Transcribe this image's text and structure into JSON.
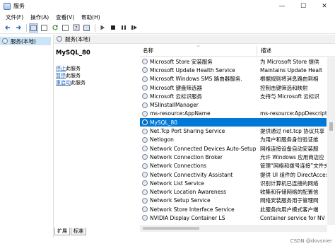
{
  "window": {
    "title": "服务",
    "minimize": "—",
    "maximize": "☐",
    "close": "✕"
  },
  "menu": [
    "文件(F)",
    "操作(A)",
    "查看(V)",
    "帮助(H)"
  ],
  "tree": {
    "root_label": "服务(本地)"
  },
  "main": {
    "header": "服务(本地)"
  },
  "detail": {
    "service_name": "MySQL_80",
    "actions": [
      {
        "link": "停止",
        "suffix": "此服务"
      },
      {
        "link": "暂停",
        "suffix": "此服务"
      },
      {
        "link": "重启动",
        "suffix": "此服务"
      }
    ]
  },
  "list": {
    "columns": {
      "name": "名称",
      "description": "描述"
    },
    "rows": [
      {
        "name": "Microsoft Store 安装服务",
        "desc": "为 Microsoft Store 提供"
      },
      {
        "name": "Microsoft Update Health Service",
        "desc": "Maintains Update Healt"
      },
      {
        "name": "Microsoft Windows SMS 路由器服务.",
        "desc": "根据规则将消息路由到相"
      },
      {
        "name": "Microsoft 键盘筛选器",
        "desc": "控制击键筛选和映射"
      },
      {
        "name": "Microsoft 云标识服务",
        "desc": "支持与 Microsoft 云标识"
      },
      {
        "name": "MSIInstallManager",
        "desc": ""
      },
      {
        "name": "ms-resource:AppName",
        "desc": "ms-resource:AppDescriptio"
      },
      {
        "name": "MySQL_80",
        "desc": ""
      },
      {
        "name": "Net.Tcp Port Sharing Service",
        "desc": "提供通过 net.tcp 协议共享"
      },
      {
        "name": "Netlogon",
        "desc": "为用户和服务身份验证维"
      },
      {
        "name": "Network Connected Devices Auto-Setup",
        "desc": "网络连接设备自动安装服"
      },
      {
        "name": "Network Connection Broker",
        "desc": "允许 Windows 应用商店应"
      },
      {
        "name": "Network Connections",
        "desc": "管理“网络和拨号连接”文件夹"
      },
      {
        "name": "Network Connectivity Assistant",
        "desc": "提供 UI 组件的 DirectAccess"
      },
      {
        "name": "Network List Service",
        "desc": "识别计算机已连接的网络"
      },
      {
        "name": "Network Location Awareness",
        "desc": "收集和存储网络的配置信"
      },
      {
        "name": "Network Setup Service",
        "desc": "网络安装服务用于管理网"
      },
      {
        "name": "Network Store Interface Service",
        "desc": "此服务向用户模式客户端"
      },
      {
        "name": "NVIDIA Display Container LS",
        "desc": "Container service for NV"
      }
    ],
    "selected_index": 7
  },
  "tabs": [
    "扩展",
    "标准"
  ],
  "watermark": "CSDN @dovsnier"
}
